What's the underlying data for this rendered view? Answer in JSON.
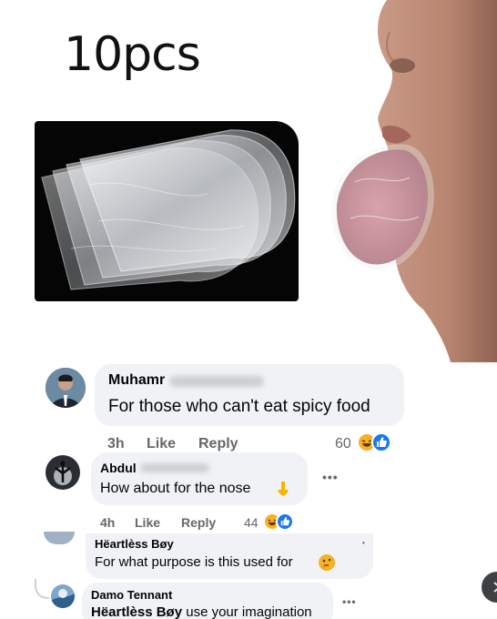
{
  "product": {
    "title": "10pcs"
  },
  "comments": [
    {
      "author": "Muhamr",
      "text": "For those who can't eat spicy food",
      "time": "3h",
      "like_label": "Like",
      "reply_label": "Reply",
      "reaction_count": "60"
    },
    {
      "author": "Abdul",
      "text": "How about for the nose",
      "time": "4h",
      "like_label": "Like",
      "reply_label": "Reply",
      "reaction_count": "44"
    },
    {
      "author": "Hëartlèss Bøy",
      "text": "For what purpose is this used for"
    },
    {
      "author": "Damo Tennant",
      "mention": "Hëartlèss Bøy",
      "text": "use your imagination"
    }
  ],
  "colors": {
    "bubble": "#f0f2f5",
    "meta_text": "#65676b",
    "like_blue": "#1877f2",
    "haha_yellow": "#f7b125"
  },
  "icons": [
    "more-icon",
    "haha-reaction-icon",
    "like-reaction-icon",
    "point-down-emoji-icon",
    "thinking-emoji-icon"
  ]
}
